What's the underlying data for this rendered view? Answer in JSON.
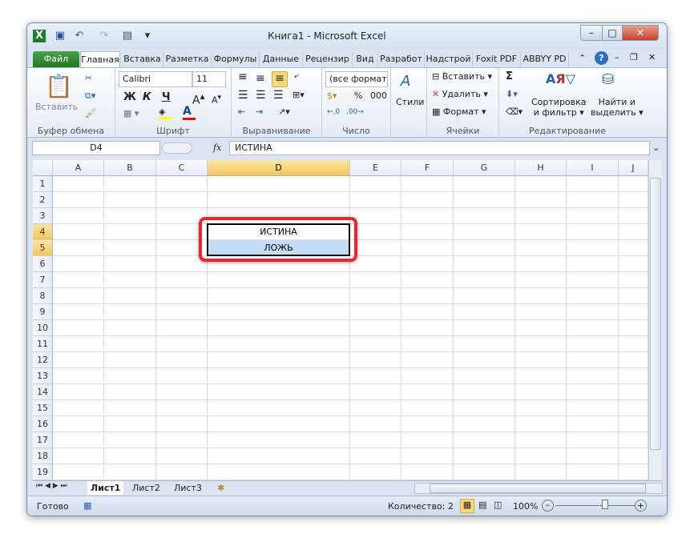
{
  "window": {
    "title": "Книга1 - Microsoft Excel"
  },
  "quick_access": [
    "excel-icon",
    "save-icon",
    "undo-icon",
    "redo-icon",
    "form-icon",
    "customize-icon"
  ],
  "tabs": [
    {
      "label": "Файл"
    },
    {
      "label": "Главная"
    },
    {
      "label": "Вставка"
    },
    {
      "label": "Разметка"
    },
    {
      "label": "Формулы"
    },
    {
      "label": "Данные"
    },
    {
      "label": "Рецензир"
    },
    {
      "label": "Вид"
    },
    {
      "label": "Разработ"
    },
    {
      "label": "Надстрой"
    },
    {
      "label": "Foxit PDF"
    },
    {
      "label": "ABBYY PD"
    }
  ],
  "ribbon": {
    "clipboard": {
      "label": "Буфер обмена",
      "paste": "Вставить"
    },
    "font": {
      "label": "Шрифт",
      "name": "Calibri",
      "size": "11",
      "bold": "Ж",
      "italic": "К",
      "underline": "Ч",
      "fill_color": "#ffff00",
      "font_color": "#ff0000"
    },
    "alignment": {
      "label": "Выравнивание"
    },
    "number": {
      "label": "Число",
      "format": "(все форматы)",
      "percent": "%",
      "thousands": "000"
    },
    "styles": {
      "label": "Стили"
    },
    "cells": {
      "label": "Ячейки",
      "insert": "Вставить",
      "delete": "Удалить",
      "format": "Формат"
    },
    "editing": {
      "label": "Редактирование",
      "sort": "Сортировка",
      "sort2": "и фильтр",
      "find": "Найти и",
      "find2": "выделить",
      "sum": "Σ"
    }
  },
  "formula_bar": {
    "name_box": "D4",
    "fx": "fx",
    "value": "ИСТИНА"
  },
  "grid": {
    "columns": [
      "A",
      "B",
      "C",
      "D",
      "E",
      "F",
      "G",
      "H",
      "I",
      "J"
    ],
    "selected_column": "D",
    "rows": [
      1,
      2,
      3,
      4,
      5,
      6,
      7,
      8,
      9,
      10,
      11,
      12,
      13,
      14,
      15,
      16,
      17,
      18,
      19
    ],
    "selected_rows": [
      4,
      5
    ],
    "cells": {
      "D4": "ИСТИНА",
      "D5": "ЛОЖЬ"
    },
    "highlight_color": "#e8262b"
  },
  "sheets": [
    {
      "label": "Лист1",
      "active": true
    },
    {
      "label": "Лист2"
    },
    {
      "label": "Лист3"
    }
  ],
  "status": {
    "ready": "Готово",
    "count": "Количество: 2",
    "zoom": "100%",
    "zoom_level": 100
  }
}
